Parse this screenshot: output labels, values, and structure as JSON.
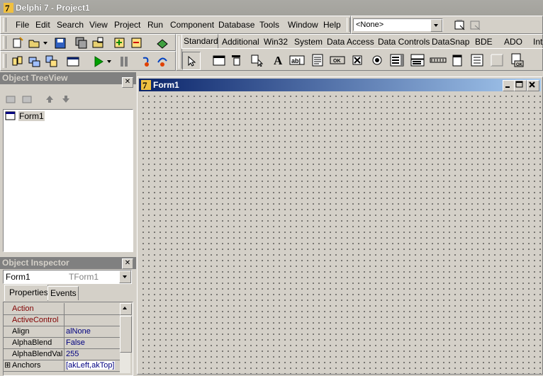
{
  "app": {
    "title": "Delphi 7 - Project1"
  },
  "menu": [
    "File",
    "Edit",
    "Search",
    "View",
    "Project",
    "Run",
    "Component",
    "Database",
    "Tools",
    "Window",
    "Help"
  ],
  "desktop_combo": {
    "value": "<None>"
  },
  "palette_tabs": [
    "Standard",
    "Additional",
    "Win32",
    "System",
    "Data Access",
    "Data Controls",
    "DataSnap",
    "BDE",
    "ADO",
    "Int"
  ],
  "treeview": {
    "title": "Object TreeView",
    "items": [
      "Form1"
    ]
  },
  "inspector": {
    "title": "Object Inspector",
    "object_name": "Form1",
    "object_type": "TForm1",
    "tabs": [
      "Properties",
      "Events"
    ],
    "properties": [
      {
        "name": "Action",
        "value": ""
      },
      {
        "name": "ActiveControl",
        "value": ""
      },
      {
        "name": "Align",
        "value": "alNone"
      },
      {
        "name": "AlphaBlend",
        "value": "False"
      },
      {
        "name": "AlphaBlendValu",
        "value": "255"
      },
      {
        "name": "Anchors",
        "value": "[akLeft,akTop]"
      }
    ],
    "expand_glyph": "⊞"
  },
  "form": {
    "title": "Form1"
  },
  "colors": {
    "form_title_start": "#0a246a",
    "form_title_end": "#a6caf0",
    "ref_prop": "#800000",
    "value": "#000080"
  }
}
